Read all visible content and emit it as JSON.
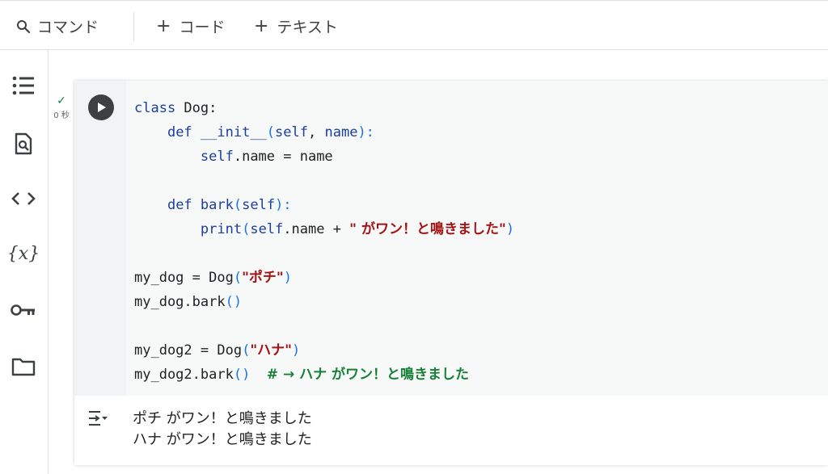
{
  "toolbar": {
    "command_label": "コマンド",
    "code_label": "コード",
    "text_label": "テキスト",
    "plus": "+"
  },
  "sidebar": {
    "icons": [
      "toc-icon",
      "find-icon",
      "code-snippets-icon",
      "variables-icon",
      "secrets-key-icon",
      "folder-icon"
    ]
  },
  "cell": {
    "exec_check": "✓",
    "exec_time": "0 秒",
    "code_lines": [
      "class Dog:",
      "    def __init__(self, name):",
      "        self.name = name",
      "",
      "    def bark(self):",
      "        print(self.name + \" がワン！と鳴きました\")",
      "",
      "my_dog = Dog(\"ポチ\")",
      "my_dog.bark()",
      "",
      "my_dog2 = Dog(\"ハナ\")",
      "my_dog2.bark()  # → ハナ がワン！と鳴きました"
    ],
    "tokens": {
      "l1_kw": "class",
      "l1_rest": " Dog:",
      "l2_ind": "    ",
      "l2_kw": "def",
      "l2_fn": " __init__",
      "l2_p1": "(",
      "l2_self": "self",
      "l2_mid": ", ",
      "l2_name": "name",
      "l2_p2": "):",
      "l3_ind": "        ",
      "l3_self": "self",
      "l3_rest": ".name = name",
      "l5_ind": "    ",
      "l5_kw": "def",
      "l5_fn": " bark",
      "l5_p1": "(",
      "l5_self": "self",
      "l5_p2": "):",
      "l6_ind": "        ",
      "l6_print": "print",
      "l6_p1": "(",
      "l6_self": "self",
      "l6_mid": ".name + ",
      "l6_str": "\" がワン！と鳴きました\"",
      "l6_p2": ")",
      "l8_a": "my_dog = Dog",
      "l8_p1": "(",
      "l8_str": "\"ポチ\"",
      "l8_p2": ")",
      "l9_a": "my_dog.bark",
      "l9_p": "()",
      "l11_a": "my_dog2 = Dog",
      "l11_p1": "(",
      "l11_str": "\"ハナ\"",
      "l11_p2": ")",
      "l12_a": "my_dog2.bark",
      "l12_p": "()",
      "l12_sp": "  ",
      "l12_cm": "# → ハナ がワン！と鳴きました"
    },
    "output_lines": [
      "ポチ がワン！と鳴きました",
      "ハナ がワン！と鳴きました"
    ]
  },
  "colors": {
    "keyword": "#1a3f9c",
    "string": "#a31515",
    "comment": "#188038",
    "bracket": "#1a73e8",
    "check": "#188038"
  }
}
